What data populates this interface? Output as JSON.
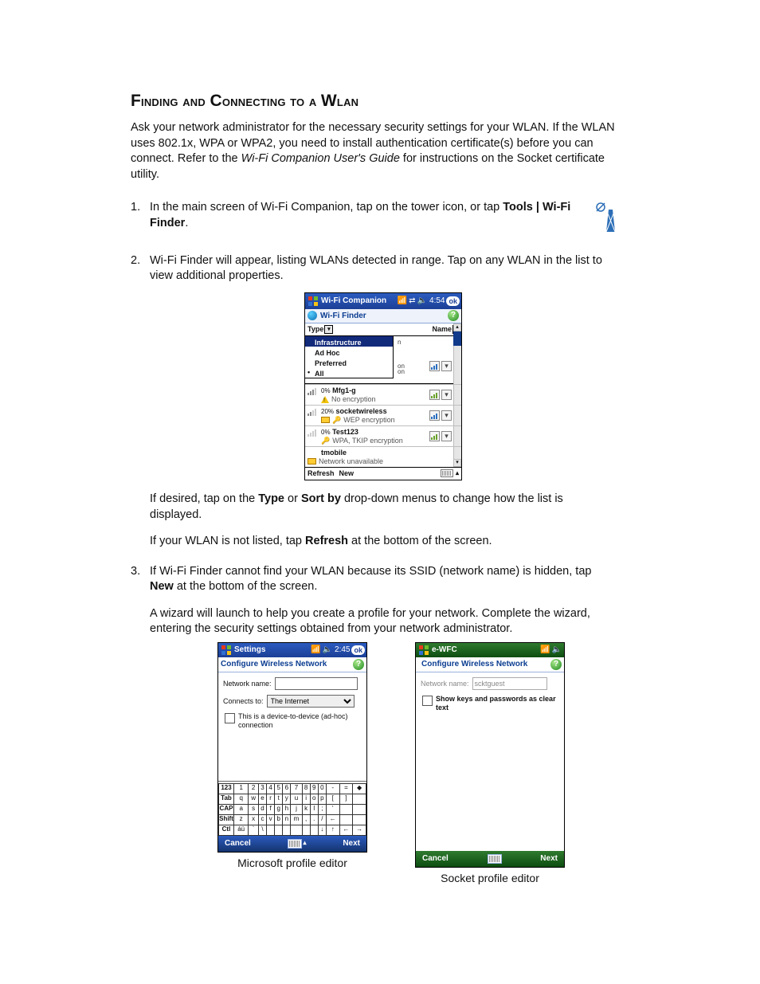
{
  "heading": "Finding and Connecting to a WLAN",
  "intro_a": "Ask your network administrator for the necessary security settings for your WLAN. If the WLAN uses 802.1x, WPA or WPA2, you need to install authentication certificate(s) before you can connect. Refer to the ",
  "intro_em": "Wi-Fi Companion User's Guide",
  "intro_b": " for instructions on the Socket certificate utility.",
  "step1_a": "In the main screen of Wi-Fi Companion, tap on the tower icon, or tap ",
  "step1_bold": "Tools | Wi-Fi Finder",
  "step1_b": ".",
  "step2": "Wi-Fi Finder will appear, listing WLANs detected in range. Tap on any WLAN in the list to view additional properties.",
  "step2_p1_a": "If desired, tap on the ",
  "step2_p1_b1": "Type",
  "step2_p1_mid": " or ",
  "step2_p1_b2": "Sort by",
  "step2_p1_c": " drop-down menus to change how the list is displayed.",
  "step2_p2_a": "If your WLAN is not listed, tap ",
  "step2_p2_b": "Refresh",
  "step2_p2_c": " at the bottom of the screen.",
  "step3_a": "If Wi-Fi Finder cannot find your WLAN because its SSID (network name) is hidden, tap ",
  "step3_b": "New",
  "step3_c": " at the bottom of the screen.",
  "step3_p1": "A wizard will launch to help you create a profile for your network. Complete the wizard, entering the security settings obtained from your network administrator.",
  "wifi_finder": {
    "titlebar_title": "Wi-Fi Companion",
    "time": "4:54",
    "ok": "ok",
    "subtitle": "Wi-Fi Finder",
    "type_label": "Type",
    "sort_label": "Name",
    "menu": [
      "Infrastructure",
      "Ad Hoc",
      "Preferred",
      "All"
    ],
    "under_rows": [
      "n",
      "on",
      "on"
    ],
    "networks": [
      {
        "pct": "0%",
        "name": "Mfg1-g",
        "sub": "No encryption",
        "warn": true,
        "color": "green"
      },
      {
        "pct": "20%",
        "name": "socketwireless",
        "sub": "WEP encryption",
        "key": true,
        "color": "blue",
        "folder": true
      },
      {
        "pct": "0%",
        "name": "Test123",
        "sub": "WPA, TKIP encryption",
        "key": true,
        "color": "green"
      },
      {
        "pct": "",
        "name": "tmobile",
        "sub": "Network unavailable",
        "folder": true,
        "noicons": true
      }
    ],
    "footer_refresh": "Refresh",
    "footer_new": "New"
  },
  "editor_ms": {
    "titlebar_title": "Settings",
    "time": "2:45",
    "ok": "ok",
    "subtitle": "Configure Wireless Network",
    "netname_label": "Network name:",
    "netname_value": "",
    "connects_label": "Connects to:",
    "connects_value": "The Internet",
    "adhoc_text": "This is a device-to-device (ad-hoc) connection",
    "kbd_rows": [
      [
        "123",
        "1",
        "2",
        "3",
        "4",
        "5",
        "6",
        "7",
        "8",
        "9",
        "0",
        "-",
        "=",
        "◆"
      ],
      [
        "Tab",
        "q",
        "w",
        "e",
        "r",
        "t",
        "y",
        "u",
        "i",
        "o",
        "p",
        "[",
        "]",
        " "
      ],
      [
        "CAP",
        "a",
        "s",
        "d",
        "f",
        "g",
        "h",
        "j",
        "k",
        "l",
        ";",
        "'",
        " ",
        " "
      ],
      [
        "Shift",
        "z",
        "x",
        "c",
        "v",
        "b",
        "n",
        "m",
        ",",
        ".",
        "/",
        "←",
        " ",
        " "
      ],
      [
        "Ctl",
        "áü",
        "`",
        "\\",
        " ",
        " ",
        " ",
        " ",
        " ",
        " ",
        "↓",
        "↑",
        "←",
        "→"
      ]
    ],
    "cancel": "Cancel",
    "next": "Next",
    "caption": "Microsoft profile editor"
  },
  "editor_socket": {
    "titlebar_title": "e-WFC",
    "subtitle": "Configure Wireless Network",
    "netname_label": "Network name:",
    "netname_value": "scktguest",
    "showkeys_text": "Show keys and passwords as clear text",
    "cancel": "Cancel",
    "next": "Next",
    "caption": "Socket profile editor"
  }
}
